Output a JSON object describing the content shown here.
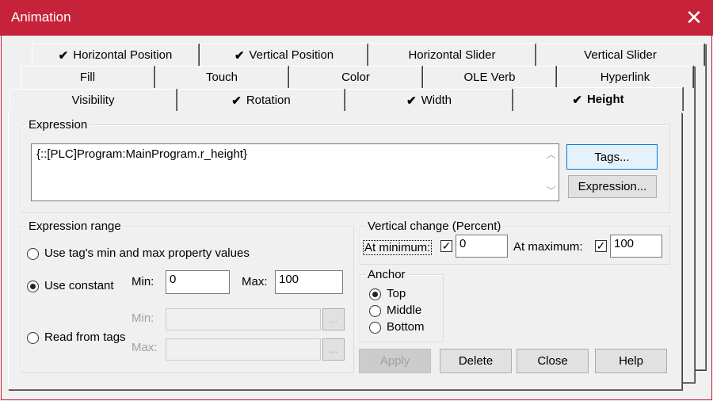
{
  "window": {
    "title": "Animation",
    "close_glyph": "✕"
  },
  "tabs": {
    "row1": [
      {
        "label": "Horizontal Position",
        "checked": true
      },
      {
        "label": "Vertical Position",
        "checked": true
      },
      {
        "label": "Horizontal Slider",
        "checked": false
      },
      {
        "label": "Vertical Slider",
        "checked": false
      }
    ],
    "row2": [
      {
        "label": "Fill",
        "checked": false
      },
      {
        "label": "Touch",
        "checked": false
      },
      {
        "label": "Color",
        "checked": false
      },
      {
        "label": "OLE Verb",
        "checked": false
      },
      {
        "label": "Hyperlink",
        "checked": false
      }
    ],
    "row3": [
      {
        "label": "Visibility",
        "checked": false
      },
      {
        "label": "Rotation",
        "checked": true
      },
      {
        "label": "Width",
        "checked": true
      },
      {
        "label": "Height",
        "checked": true,
        "active": true
      }
    ],
    "check_glyph": "✔"
  },
  "expression": {
    "group_label": "Expression",
    "value": "{::[PLC]Program:MainProgram.r_height}",
    "tags_button": "Tags...",
    "expression_button": "Expression..."
  },
  "range": {
    "group_label": "Expression range",
    "opt_tag": "Use tag's min and max property values",
    "opt_constant": "Use constant",
    "opt_read": "Read from tags",
    "selected": "constant",
    "min_label": "Min:",
    "max_label": "Max:",
    "min_value": "0",
    "max_value": "100",
    "tag_min_label": "Min:",
    "tag_max_label": "Max:",
    "browse_glyph": "..."
  },
  "vertical_change": {
    "group_label": "Vertical change (Percent)",
    "at_min_label": "At minimum:",
    "at_min_checked": true,
    "at_min_value": "0",
    "at_max_label": "At maximum:",
    "at_max_checked": true,
    "at_max_value": "100",
    "check_glyph": "✓"
  },
  "anchor": {
    "group_label": "Anchor",
    "options": [
      "Top",
      "Middle",
      "Bottom"
    ],
    "selected": "Top"
  },
  "buttons": {
    "apply": "Apply",
    "delete": "Delete",
    "close": "Close",
    "help": "Help"
  }
}
